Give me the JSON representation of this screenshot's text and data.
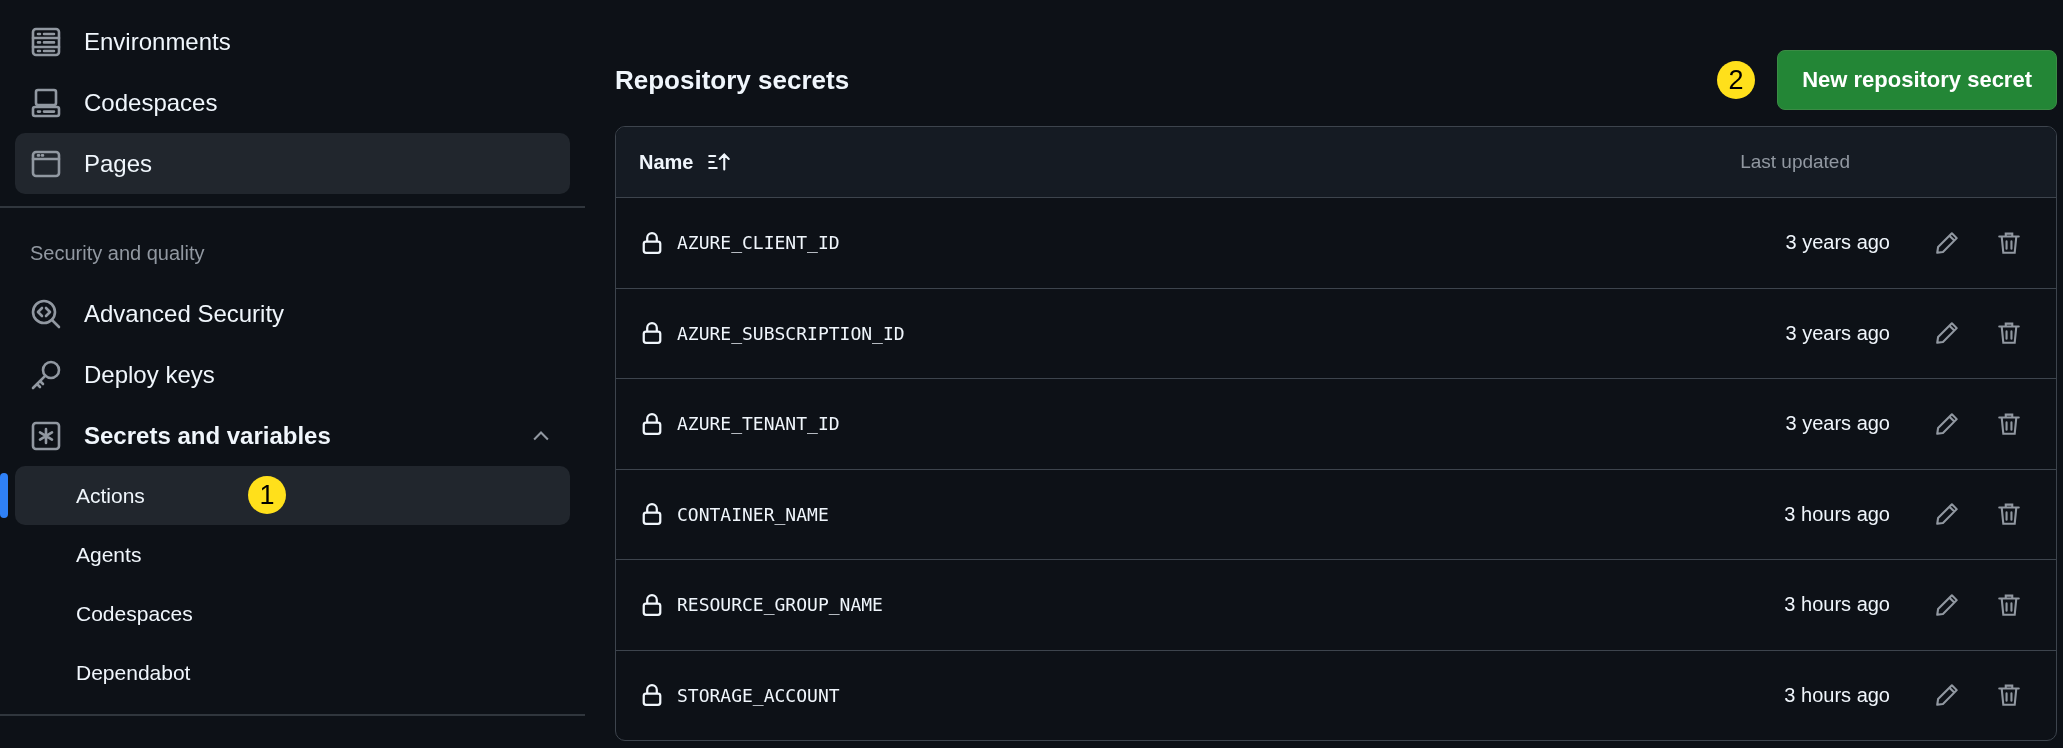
{
  "sidebar": {
    "top_items": [
      {
        "label": "Environments",
        "highlighted": false
      },
      {
        "label": "Codespaces",
        "highlighted": false
      },
      {
        "label": "Pages",
        "highlighted": true
      }
    ],
    "section": {
      "heading": "Security and quality",
      "items": [
        {
          "label": "Advanced Security"
        },
        {
          "label": "Deploy keys"
        },
        {
          "label": "Secrets and variables",
          "expanded": true,
          "children": [
            {
              "label": "Actions",
              "selected": true,
              "callout": "1"
            },
            {
              "label": "Agents",
              "selected": false
            },
            {
              "label": "Codespaces",
              "selected": false
            },
            {
              "label": "Dependabot",
              "selected": false
            }
          ]
        }
      ]
    }
  },
  "main": {
    "title": "Repository secrets",
    "callout": "2",
    "new_button": "New repository secret",
    "table": {
      "columns": [
        "Name",
        "Last updated"
      ],
      "rows": [
        {
          "name": "AZURE_CLIENT_ID",
          "updated": "3 years ago"
        },
        {
          "name": "AZURE_SUBSCRIPTION_ID",
          "updated": "3 years ago"
        },
        {
          "name": "AZURE_TENANT_ID",
          "updated": "3 years ago"
        },
        {
          "name": "CONTAINER_NAME",
          "updated": "3 hours ago"
        },
        {
          "name": "RESOURCE_GROUP_NAME",
          "updated": "3 hours ago"
        },
        {
          "name": "STORAGE_ACCOUNT",
          "updated": "3 hours ago"
        }
      ]
    }
  }
}
